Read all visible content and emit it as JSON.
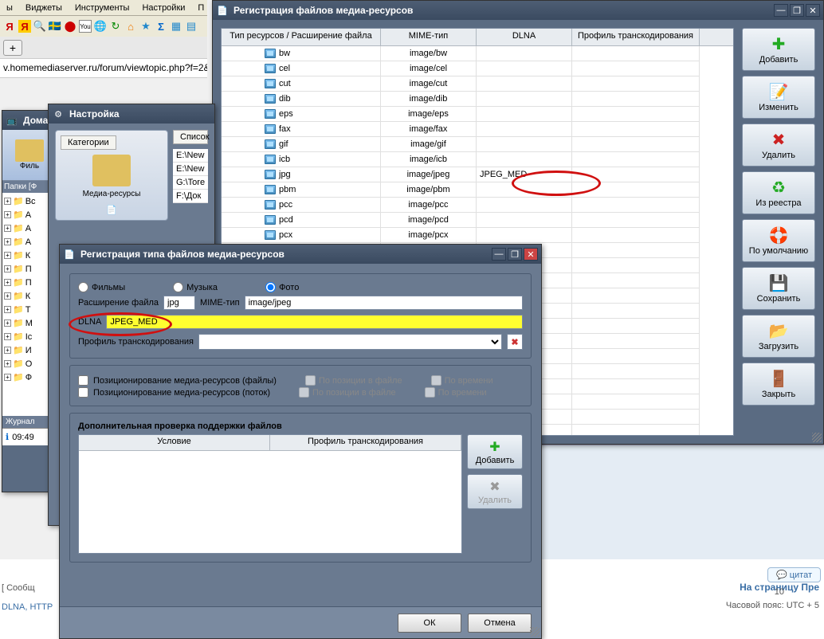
{
  "browser": {
    "menu": [
      "ы",
      "Виджеты",
      "Инструменты",
      "Настройки",
      "П"
    ],
    "url": "v.homemediaserver.ru/forum/viewtopic.php?f=2&t=8398",
    "tab_plus": "+"
  },
  "page": {
    "quote": "цитат",
    "to_page": "На страницу Пре",
    "timezone": "Часовой пояс: UTC + 5",
    "msg": "[ Сообщ",
    "dlna_http": "DLNA, HTTP"
  },
  "tree_win": {
    "title": "Дома",
    "films": "Филь",
    "folders_tab": "Папки [Ф",
    "items": [
      "Вс",
      "А",
      "А",
      "А",
      "К",
      "П",
      "П",
      "К",
      "Т",
      "М",
      "Ic",
      "И",
      "О",
      "Ф"
    ],
    "journal": "Журнал",
    "time": "09:49"
  },
  "settings_win": {
    "title": "Настройка",
    "categories": "Категории",
    "media_res": "Медиа-ресурсы",
    "list": "Список",
    "paths": [
      "E:\\New",
      "E:\\New",
      "G:\\Tore",
      "F:\\Док"
    ]
  },
  "reg_win": {
    "title": "Регистрация файлов медиа-ресурсов",
    "columns": [
      "Тип ресурсов / Расширение файла",
      "MIME-тип",
      "DLNA",
      "Профиль транскодирования"
    ],
    "rows": [
      {
        "ext": "bw",
        "mime": "image/bw",
        "dlna": ""
      },
      {
        "ext": "cel",
        "mime": "image/cel",
        "dlna": ""
      },
      {
        "ext": "cut",
        "mime": "image/cut",
        "dlna": ""
      },
      {
        "ext": "dib",
        "mime": "image/dib",
        "dlna": ""
      },
      {
        "ext": "eps",
        "mime": "image/eps",
        "dlna": ""
      },
      {
        "ext": "fax",
        "mime": "image/fax",
        "dlna": ""
      },
      {
        "ext": "gif",
        "mime": "image/gif",
        "dlna": ""
      },
      {
        "ext": "icb",
        "mime": "image/icb",
        "dlna": ""
      },
      {
        "ext": "jpg",
        "mime": "image/jpeg",
        "dlna": "JPEG_MED"
      },
      {
        "ext": "pbm",
        "mime": "image/pbm",
        "dlna": ""
      },
      {
        "ext": "pcc",
        "mime": "image/pcc",
        "dlna": ""
      },
      {
        "ext": "pcd",
        "mime": "image/pcd",
        "dlna": ""
      },
      {
        "ext": "pcx",
        "mime": "image/pcx",
        "dlna": ""
      }
    ],
    "buttons": {
      "add": "Добавить",
      "edit": "Изменить",
      "delete": "Удалить",
      "registry": "Из реестра",
      "defaults": "По умолчанию",
      "save": "Сохранить",
      "load": "Загрузить",
      "close": "Закрыть"
    }
  },
  "dialog": {
    "title": "Регистрация типа файлов медиа-ресурсов",
    "radios": {
      "films": "Фильмы",
      "music": "Музыка",
      "photo": "Фото"
    },
    "ext_label": "Расширение файла",
    "ext_val": "jpg",
    "mime_label": "MIME-тип",
    "mime_val": "image/jpeg",
    "dlna_label": "DLNA",
    "dlna_val": "JPEG_MED",
    "profile_label": "Профиль транскодирования",
    "pos_files": "Позиционирование медиа-ресурсов (файлы)",
    "pos_stream": "Позиционирование медиа-ресурсов (поток)",
    "by_pos": "По позиции в файле",
    "by_time": "По времени",
    "extra_check": "Дополнительная проверка поддержки файлов",
    "cond": "Условие",
    "prof": "Профиль транскодирования",
    "add": "Добавить",
    "del": "Удалить",
    "ok": "ОК",
    "cancel": "Отмена"
  }
}
